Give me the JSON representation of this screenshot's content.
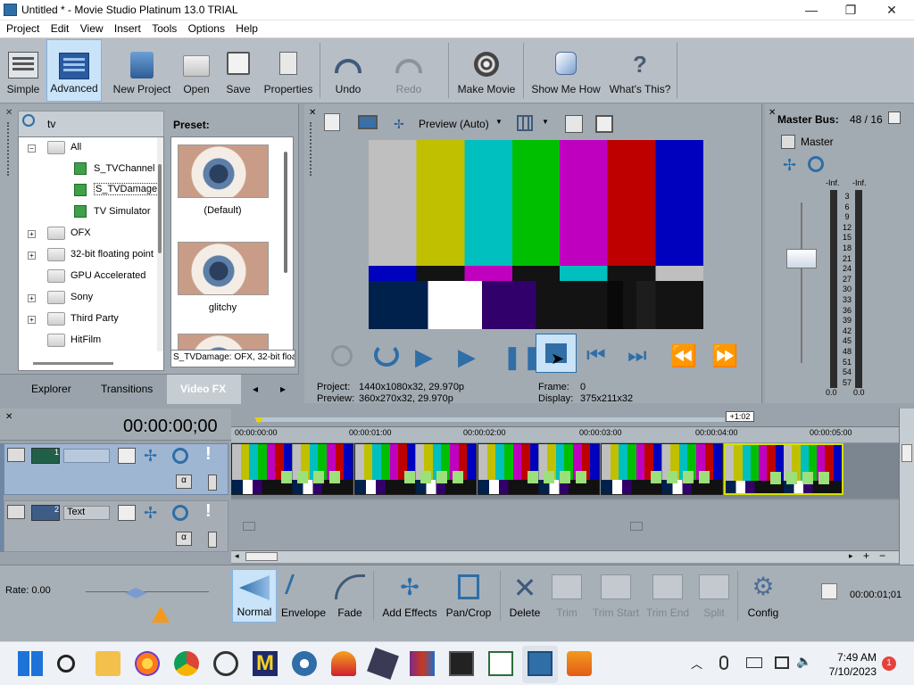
{
  "window": {
    "title": "Untitled * - Movie Studio Platinum 13.0 TRIAL",
    "minimize": "—",
    "maximize": "❐",
    "close": "✕"
  },
  "menu": [
    "Project",
    "Edit",
    "View",
    "Insert",
    "Tools",
    "Options",
    "Help"
  ],
  "toolbar": {
    "simple": "Simple",
    "advanced": "Advanced",
    "new_project": "New Project",
    "open": "Open",
    "save": "Save",
    "properties": "Properties",
    "undo": "Undo",
    "redo": "Redo",
    "make_movie": "Make Movie",
    "show_me_how": "Show Me How",
    "whats_this": "What's This?"
  },
  "explorer": {
    "search_value": "tv",
    "preset_label": "Preset:",
    "tree": [
      "All",
      "S_TVChannel",
      "S_TVDamage",
      "TV Simulator",
      "OFX",
      "32-bit floating point",
      "GPU Accelerated",
      "Sony",
      "Third Party",
      "HitFilm"
    ],
    "presets": [
      "(Default)",
      "glitchy"
    ],
    "status": "S_TVDamage: OFX, 32-bit floating point",
    "tabs": [
      "Explorer",
      "Transitions",
      "Video FX"
    ]
  },
  "preview": {
    "mode": "Preview (Auto)",
    "project_label": "Project:",
    "project_value": "1440x1080x32, 29.970p",
    "preview_label": "Preview:",
    "preview_value": "360x270x32, 29.970p",
    "frame_label": "Frame:",
    "frame_value": "0",
    "display_label": "Display:",
    "display_value": "375x211x32"
  },
  "master": {
    "title": "Master Bus:",
    "value": "48 / 16",
    "label": "Master",
    "inf_left": "-Inf.",
    "inf_right": "-Inf.",
    "scale": [
      "3",
      "6",
      "9",
      "12",
      "15",
      "18",
      "21",
      "24",
      "27",
      "30",
      "33",
      "36",
      "39",
      "42",
      "45",
      "48",
      "51",
      "54",
      "57"
    ],
    "bottom_left": "0.0",
    "bottom_right": "0.0"
  },
  "timeline": {
    "timecode": "00:00:00;00",
    "ruler": [
      "00:00:00:00",
      "00:00:01:00",
      "00:00:02:00",
      "00:00:03:00",
      "00:00:04:00",
      "00:00:05:00"
    ],
    "marker": "+1:02",
    "tracks": [
      {
        "num": "1",
        "name": ""
      },
      {
        "num": "2",
        "name": "Text"
      }
    ],
    "rate": "Rate: 0.00",
    "cursor_time": "00:00:01;01"
  },
  "edit_toolbar": {
    "normal": "Normal",
    "envelope": "Envelope",
    "fade": "Fade",
    "add_effects": "Add Effects",
    "pan_crop": "Pan/Crop",
    "delete": "Delete",
    "trim": "Trim",
    "trim_start": "Trim Start",
    "trim_end": "Trim End",
    "split": "Split",
    "config": "Config"
  },
  "taskbar": {
    "time": "7:49 AM",
    "date": "7/10/2023",
    "badge": "1"
  },
  "colors": {
    "accent": "#1f6fd1",
    "selection": "#c9e3f8",
    "panel": "#a3abb2",
    "clip_border": "#d4e000"
  }
}
